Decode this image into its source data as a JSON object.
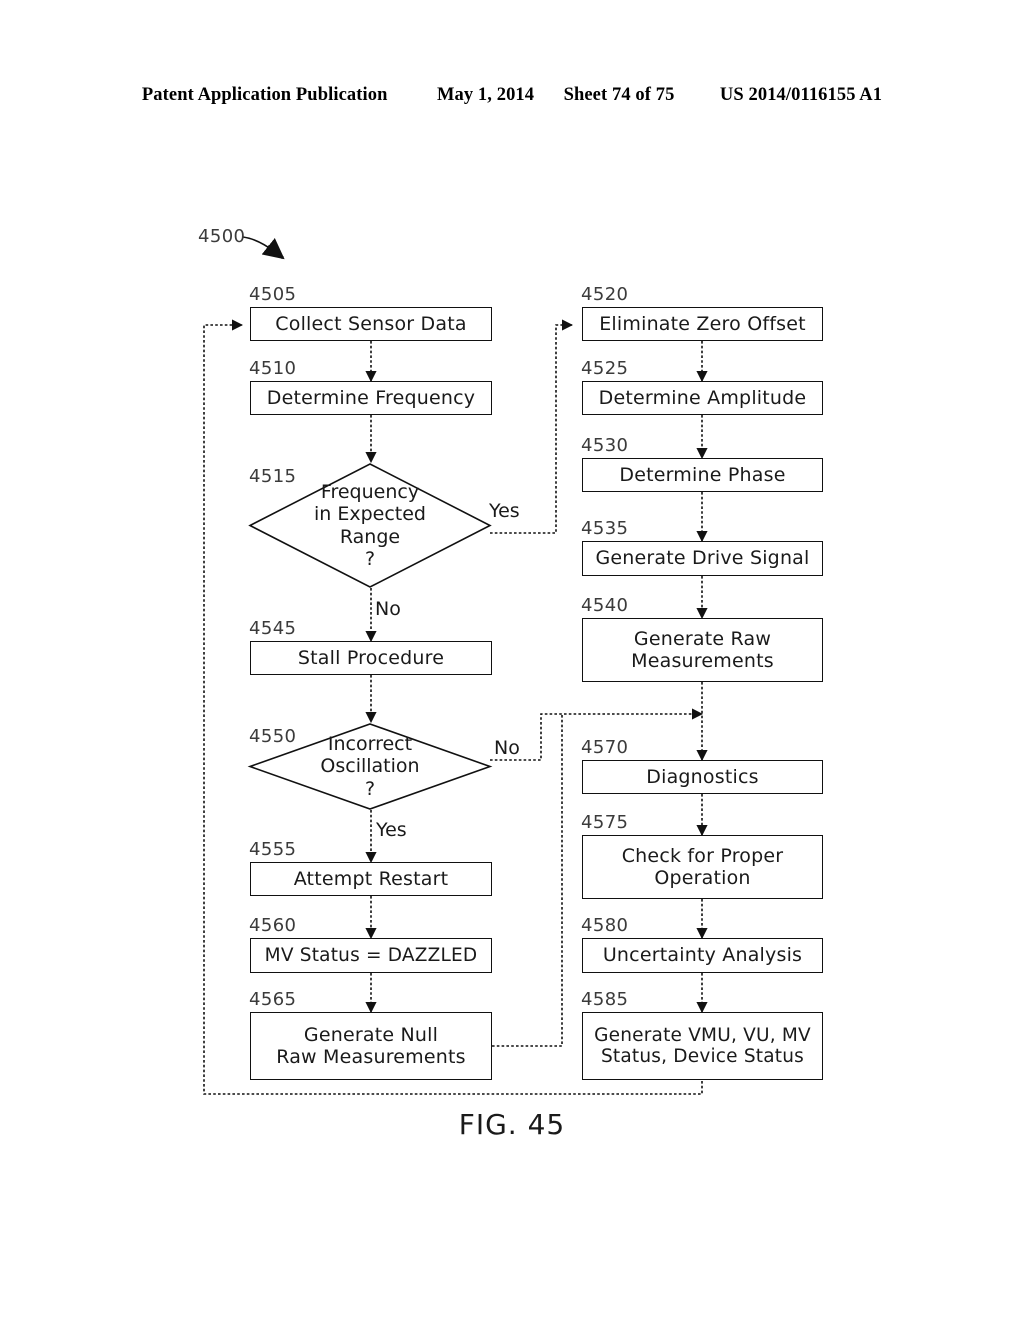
{
  "header": {
    "publication": "Patent Application Publication",
    "date": "May 1, 2014",
    "sheet": "Sheet 74 of 75",
    "patent_number": "US 2014/0116155 A1"
  },
  "figure": {
    "caption": "FIG. 45",
    "diagram_ref": "4500",
    "nodes": [
      {
        "ref": "4505",
        "label": "Collect Sensor Data",
        "shape": "process",
        "column": "left"
      },
      {
        "ref": "4510",
        "label": "Determine Frequency",
        "shape": "process",
        "column": "left"
      },
      {
        "ref": "4515",
        "label": "Frequency\nin Expected\nRange\n?",
        "shape": "decision",
        "column": "left"
      },
      {
        "ref": "4545",
        "label": "Stall Procedure",
        "shape": "process",
        "column": "left"
      },
      {
        "ref": "4550",
        "label": "Incorrect\nOscillation\n?",
        "shape": "decision",
        "column": "left"
      },
      {
        "ref": "4555",
        "label": "Attempt Restart",
        "shape": "process",
        "column": "left"
      },
      {
        "ref": "4560",
        "label": "MV Status = DAZZLED",
        "shape": "process",
        "column": "left"
      },
      {
        "ref": "4565",
        "label": "Generate Null\nRaw Measurements",
        "shape": "process",
        "column": "left"
      },
      {
        "ref": "4520",
        "label": "Eliminate Zero Offset",
        "shape": "process",
        "column": "right"
      },
      {
        "ref": "4525",
        "label": "Determine Amplitude",
        "shape": "process",
        "column": "right"
      },
      {
        "ref": "4530",
        "label": "Determine Phase",
        "shape": "process",
        "column": "right"
      },
      {
        "ref": "4535",
        "label": "Generate Drive Signal",
        "shape": "process",
        "column": "right"
      },
      {
        "ref": "4540",
        "label": "Generate Raw\nMeasurements",
        "shape": "process",
        "column": "right"
      },
      {
        "ref": "4570",
        "label": "Diagnostics",
        "shape": "process",
        "column": "right"
      },
      {
        "ref": "4575",
        "label": "Check for Proper\nOperation",
        "shape": "process",
        "column": "right"
      },
      {
        "ref": "4580",
        "label": "Uncertainty Analysis",
        "shape": "process",
        "column": "right"
      },
      {
        "ref": "4585",
        "label": "Generate VMU, VU, MV\nStatus, Device Status",
        "shape": "process",
        "column": "right"
      }
    ],
    "node_text": {
      "n4505": "Collect Sensor Data",
      "n4510": "Determine Frequency",
      "n4515_l1": "Frequency",
      "n4515_l2": "in Expected",
      "n4515_l3": "Range",
      "n4515_l4": "?",
      "n4545": "Stall Procedure",
      "n4550_l1": "Incorrect",
      "n4550_l2": "Oscillation",
      "n4550_l3": "?",
      "n4555": "Attempt Restart",
      "n4560": "MV Status = DAZZLED",
      "n4565_l1": "Generate Null",
      "n4565_l2": "Raw Measurements",
      "n4520": "Eliminate Zero Offset",
      "n4525": "Determine Amplitude",
      "n4530": "Determine Phase",
      "n4535": "Generate Drive Signal",
      "n4540_l1": "Generate Raw",
      "n4540_l2": "Measurements",
      "n4570": "Diagnostics",
      "n4575_l1": "Check for Proper",
      "n4575_l2": "Operation",
      "n4580": "Uncertainty Analysis",
      "n4585_l1": "Generate VMU, VU, MV",
      "n4585_l2": "Status, Device Status"
    },
    "refs": {
      "r4500": "4500",
      "r4505": "4505",
      "r4510": "4510",
      "r4515": "4515",
      "r4520": "4520",
      "r4525": "4525",
      "r4530": "4530",
      "r4535": "4535",
      "r4540": "4540",
      "r4545": "4545",
      "r4550": "4550",
      "r4555": "4555",
      "r4560": "4560",
      "r4565": "4565",
      "r4570": "4570",
      "r4575": "4575",
      "r4580": "4580",
      "r4585": "4585"
    },
    "edge_labels": {
      "yes_4515": "Yes",
      "no_4515": "No",
      "no_4550": "No",
      "yes_4550": "Yes"
    }
  }
}
